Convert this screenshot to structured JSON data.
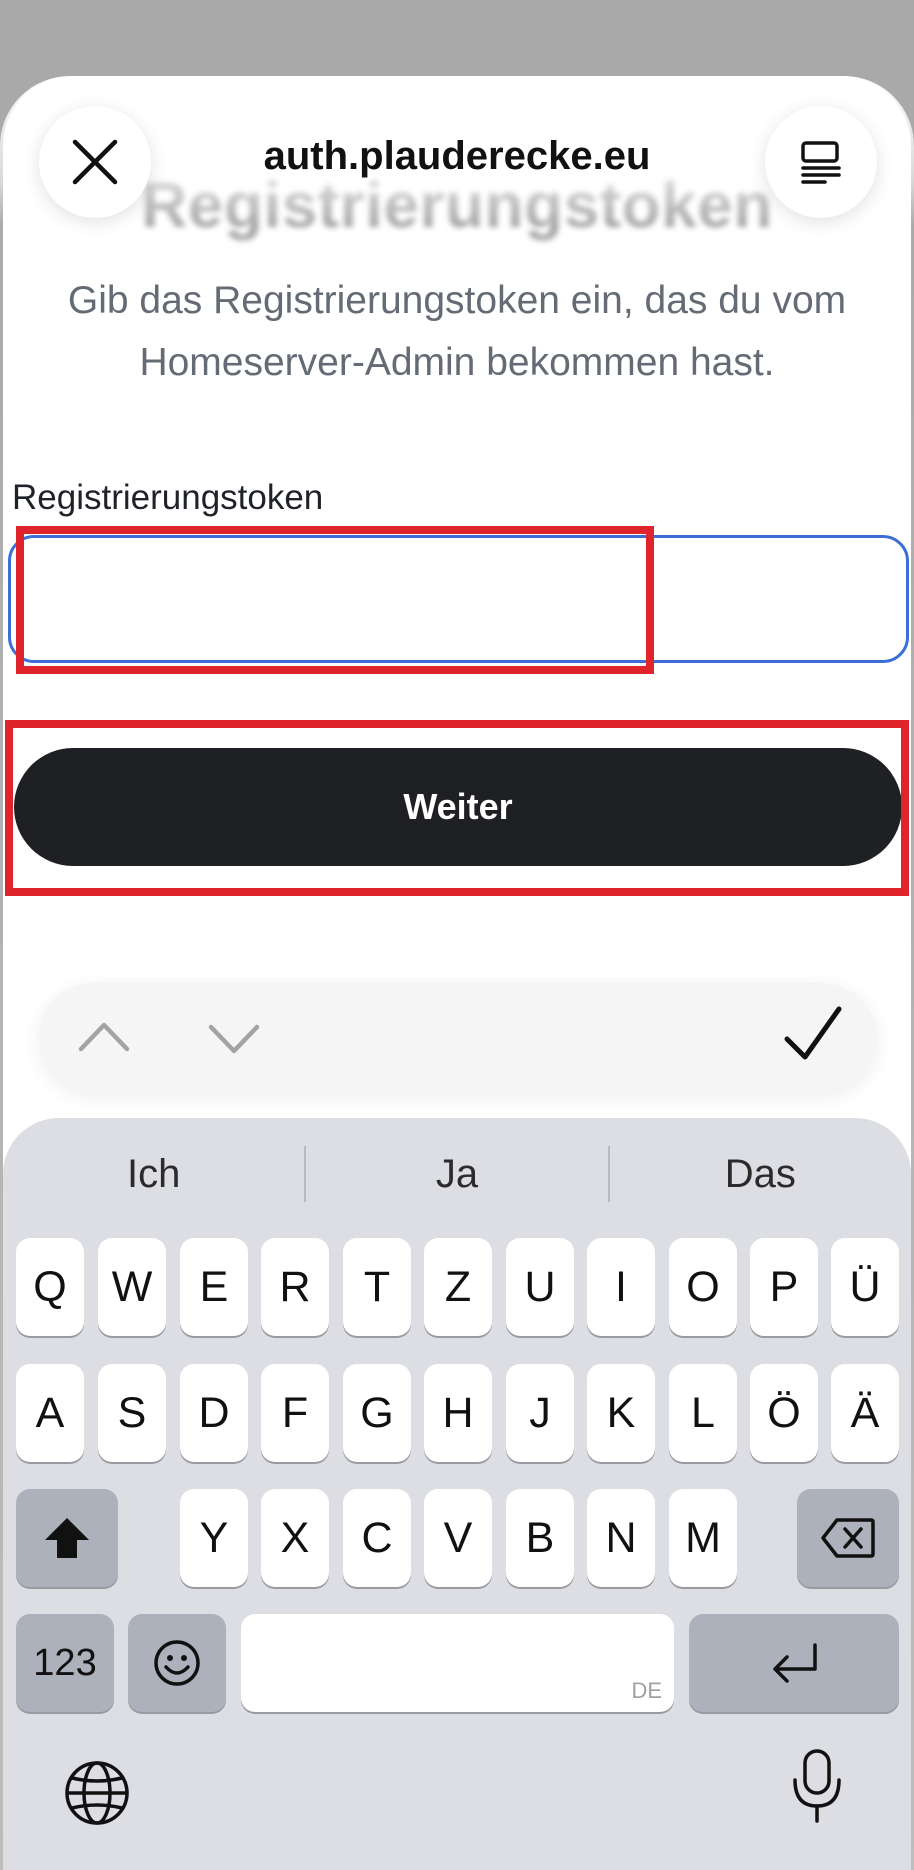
{
  "browser": {
    "url_title": "auth.plauderecke.eu",
    "close_icon": "close-icon",
    "reader_icon": "reader-mode-icon"
  },
  "page": {
    "heading": "Registrierungstoken",
    "subtitle": "Gib das Registrierungstoken ein, das du vom Homeserver-Admin bekommen hast.",
    "field_label": "Registrierungstoken",
    "field_value": "",
    "continue_label": "Weiter"
  },
  "accessory_bar": {
    "up_icon": "chevron-up-icon",
    "down_icon": "chevron-down-icon",
    "done_icon": "checkmark-icon"
  },
  "keyboard": {
    "suggestions": [
      "Ich",
      "Ja",
      "Das"
    ],
    "row1": [
      "Q",
      "W",
      "E",
      "R",
      "T",
      "Z",
      "U",
      "I",
      "O",
      "P",
      "Ü"
    ],
    "row2": [
      "A",
      "S",
      "D",
      "F",
      "G",
      "H",
      "J",
      "K",
      "L",
      "Ö",
      "Ä"
    ],
    "row3": [
      "Y",
      "X",
      "C",
      "V",
      "B",
      "N",
      "M"
    ],
    "numbers_label": "123",
    "space_lang_tag": "DE",
    "icons": {
      "shift": "shift-icon",
      "delete": "delete-icon",
      "emoji": "emoji-icon",
      "return": "return-icon",
      "globe": "globe-icon",
      "mic": "microphone-icon"
    }
  },
  "colors": {
    "accent_border": "#3b6fd6",
    "button_bg": "#1f2023",
    "annotation_red": "#e0242b",
    "keyboard_bg": "#dddee3"
  }
}
